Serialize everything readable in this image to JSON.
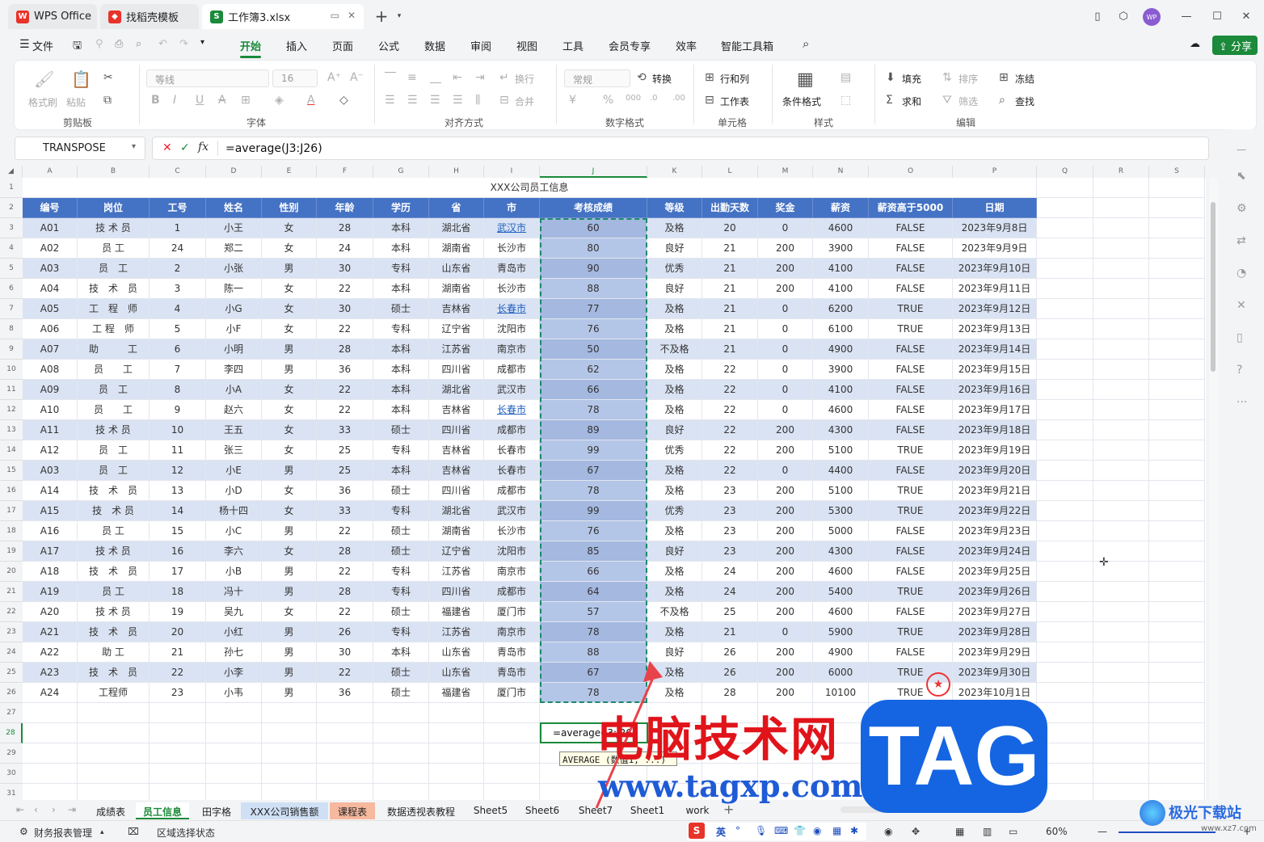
{
  "window": {
    "tabs": [
      {
        "label": "WPS Office"
      },
      {
        "label": "找稻壳模板"
      },
      {
        "label": "工作簿3.xlsx"
      }
    ],
    "avatar_text": "WP",
    "share_label": "分享"
  },
  "menu": [
    "文件",
    "开始",
    "插入",
    "页面",
    "公式",
    "数据",
    "审阅",
    "视图",
    "工具",
    "会员专享",
    "效率",
    "智能工具箱"
  ],
  "ribbon": {
    "clipboard": {
      "format_painter": "格式刷",
      "paste": "粘贴",
      "group": "剪贴板"
    },
    "font": {
      "name": "等线",
      "size": "16",
      "group": "字体"
    },
    "align": {
      "wrap": "换行",
      "merge": "合并",
      "group": "对齐方式"
    },
    "number": {
      "format": "常规",
      "convert": "转换",
      "group": "数字格式"
    },
    "cells": {
      "rowcol": "行和列",
      "worksheet": "工作表",
      "group": "单元格"
    },
    "style": {
      "cond_format": "条件格式",
      "group": "样式"
    },
    "edit": {
      "fill": "填充",
      "sort": "排序",
      "freeze": "冻结",
      "sum": "求和",
      "filter": "筛选",
      "find": "查找",
      "group": "编辑"
    }
  },
  "formula": {
    "name_box": "TRANSPOSE",
    "fx": "fx",
    "text": "=average(J3:J26)"
  },
  "columns": [
    "A",
    "B",
    "C",
    "D",
    "E",
    "F",
    "G",
    "H",
    "I",
    "J",
    "K",
    "L",
    "M",
    "N",
    "O",
    "P",
    "Q",
    "R",
    "S"
  ],
  "rows": [
    "1",
    "2",
    "3",
    "4",
    "5",
    "6",
    "7",
    "8",
    "9",
    "10",
    "11",
    "12",
    "13",
    "14",
    "15",
    "16",
    "17",
    "18",
    "19",
    "20",
    "21",
    "22",
    "23",
    "24",
    "25",
    "26",
    "27",
    "28",
    "29",
    "30",
    "31"
  ],
  "table": {
    "title": "XXX公司员工信息",
    "headers": [
      "编号",
      "岗位",
      "工号",
      "姓名",
      "性别",
      "年龄",
      "学历",
      "省",
      "市",
      "考核成绩",
      "等级",
      "出勤天数",
      "奖金",
      "薪资",
      "薪资高于5000",
      "日期"
    ],
    "rows": [
      [
        "A01",
        "技 术 员",
        "1",
        "小王",
        "女",
        "28",
        "本科",
        "湖北省",
        "武汉市",
        "60",
        "及格",
        "20",
        "0",
        "4600",
        "FALSE",
        "2023年9月8日"
      ],
      [
        "A02",
        "员 工",
        "24",
        "郑二",
        "女",
        "24",
        "本科",
        "湖南省",
        "长沙市",
        "80",
        "良好",
        "21",
        "200",
        "3900",
        "FALSE",
        "2023年9月9日"
      ],
      [
        "A03",
        "员　工",
        "2",
        "小张",
        "男",
        "30",
        "专科",
        "山东省",
        "青岛市",
        "90",
        "优秀",
        "21",
        "200",
        "4100",
        "FALSE",
        "2023年9月10日"
      ],
      [
        "A04",
        "技　术　员",
        "3",
        "陈一",
        "女",
        "22",
        "本科",
        "湖南省",
        "长沙市",
        "88",
        "良好",
        "21",
        "200",
        "4100",
        "FALSE",
        "2023年9月11日"
      ],
      [
        "A05",
        "工　程　师",
        "4",
        "小G",
        "女",
        "30",
        "硕士",
        "吉林省",
        "长春市",
        "77",
        "及格",
        "21",
        "0",
        "6200",
        "TRUE",
        "2023年9月12日"
      ],
      [
        "A06",
        "工 程　师",
        "5",
        "小F",
        "女",
        "22",
        "专科",
        "辽宁省",
        "沈阳市",
        "76",
        "及格",
        "21",
        "0",
        "6100",
        "TRUE",
        "2023年9月13日"
      ],
      [
        "A07",
        "助　　　工",
        "6",
        "小明",
        "男",
        "28",
        "本科",
        "江苏省",
        "南京市",
        "50",
        "不及格",
        "21",
        "0",
        "4900",
        "FALSE",
        "2023年9月14日"
      ],
      [
        "A08",
        "员　　工",
        "7",
        "李四",
        "男",
        "36",
        "本科",
        "四川省",
        "成都市",
        "62",
        "及格",
        "22",
        "0",
        "3900",
        "FALSE",
        "2023年9月15日"
      ],
      [
        "A09",
        "员　工",
        "8",
        "小A",
        "女",
        "22",
        "本科",
        "湖北省",
        "武汉市",
        "66",
        "及格",
        "22",
        "0",
        "4100",
        "FALSE",
        "2023年9月16日"
      ],
      [
        "A10",
        "员　　工",
        "9",
        "赵六",
        "女",
        "22",
        "本科",
        "吉林省",
        "长春市",
        "78",
        "及格",
        "22",
        "0",
        "4600",
        "FALSE",
        "2023年9月17日"
      ],
      [
        "A11",
        "技 术 员",
        "10",
        "王五",
        "女",
        "33",
        "硕士",
        "四川省",
        "成都市",
        "89",
        "良好",
        "22",
        "200",
        "4300",
        "FALSE",
        "2023年9月18日"
      ],
      [
        "A12",
        "员　工",
        "11",
        "张三",
        "女",
        "25",
        "专科",
        "吉林省",
        "长春市",
        "99",
        "优秀",
        "22",
        "200",
        "5100",
        "TRUE",
        "2023年9月19日"
      ],
      [
        "A03",
        "员　工",
        "12",
        "小E",
        "男",
        "25",
        "本科",
        "吉林省",
        "长春市",
        "67",
        "及格",
        "22",
        "0",
        "4400",
        "FALSE",
        "2023年9月20日"
      ],
      [
        "A14",
        "技　术　员",
        "13",
        "小D",
        "女",
        "36",
        "硕士",
        "四川省",
        "成都市",
        "78",
        "及格",
        "23",
        "200",
        "5100",
        "TRUE",
        "2023年9月21日"
      ],
      [
        "A15",
        "技　术 员",
        "14",
        "杨十四",
        "女",
        "33",
        "专科",
        "湖北省",
        "武汉市",
        "99",
        "优秀",
        "23",
        "200",
        "5300",
        "TRUE",
        "2023年9月22日"
      ],
      [
        "A16",
        "员 工",
        "15",
        "小C",
        "男",
        "22",
        "硕士",
        "湖南省",
        "长沙市",
        "76",
        "及格",
        "23",
        "200",
        "5000",
        "FALSE",
        "2023年9月23日"
      ],
      [
        "A17",
        "技 术 员",
        "16",
        "李六",
        "女",
        "28",
        "硕士",
        "辽宁省",
        "沈阳市",
        "85",
        "良好",
        "23",
        "200",
        "4300",
        "FALSE",
        "2023年9月24日"
      ],
      [
        "A18",
        "技　术　员",
        "17",
        "小B",
        "男",
        "22",
        "专科",
        "江苏省",
        "南京市",
        "66",
        "及格",
        "24",
        "200",
        "4600",
        "FALSE",
        "2023年9月25日"
      ],
      [
        "A19",
        "员 工",
        "18",
        "冯十",
        "男",
        "28",
        "专科",
        "四川省",
        "成都市",
        "64",
        "及格",
        "24",
        "200",
        "5400",
        "TRUE",
        "2023年9月26日"
      ],
      [
        "A20",
        "技 术 员",
        "19",
        "吴九",
        "女",
        "22",
        "硕士",
        "福建省",
        "厦门市",
        "57",
        "不及格",
        "25",
        "200",
        "4600",
        "FALSE",
        "2023年9月27日"
      ],
      [
        "A21",
        "技　术　员",
        "20",
        "小红",
        "男",
        "26",
        "专科",
        "江苏省",
        "南京市",
        "78",
        "及格",
        "21",
        "0",
        "5900",
        "TRUE",
        "2023年9月28日"
      ],
      [
        "A22",
        "助 工",
        "21",
        "孙七",
        "男",
        "30",
        "本科",
        "山东省",
        "青岛市",
        "88",
        "良好",
        "26",
        "200",
        "4900",
        "FALSE",
        "2023年9月29日"
      ],
      [
        "A23",
        "技　术　员",
        "22",
        "小李",
        "男",
        "22",
        "硕士",
        "山东省",
        "青岛市",
        "67",
        "及格",
        "26",
        "200",
        "6000",
        "TRUE",
        "2023年9月30日"
      ],
      [
        "A24",
        "工程师",
        "23",
        "小韦",
        "男",
        "36",
        "硕士",
        "福建省",
        "厦门市",
        "78",
        "及格",
        "28",
        "200",
        "10100",
        "TRUE",
        "2023年10月1日"
      ]
    ],
    "linked_cells": [
      "0-8",
      "4-8",
      "9-8"
    ]
  },
  "editing": {
    "cell_text": "=average(J3:J26)",
    "tooltip": "AVERAGE (数值1, ...)"
  },
  "sheet_tabs": [
    "成绩表",
    "员工信息",
    "田字格",
    "XXX公司销售额",
    "课程表",
    "数据透视表教程",
    "Sheet5",
    "Sheet6",
    "Sheet7",
    "Sheet1",
    "work"
  ],
  "status": {
    "left1": "财务报表管理",
    "left2": "区域选择状态",
    "ime": "英",
    "zoom": "60%"
  },
  "watermark": {
    "line1": "电脑技术网",
    "line2": "www.tagxp.com",
    "tag": "TAG",
    "site": "极光下载站",
    "site_url": "www.xz7.com"
  },
  "colors": {
    "accent": "#1b8a3a",
    "header_blue": "#4472c4",
    "band": "#dae3f3",
    "selection": "#b4c6e7"
  }
}
